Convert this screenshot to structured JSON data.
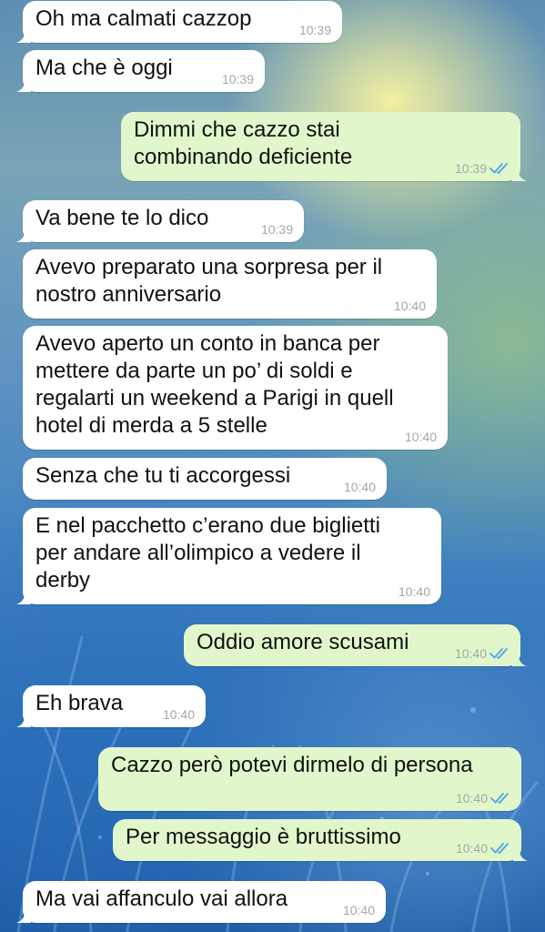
{
  "messages": [
    {
      "dir": "in",
      "text": "Oh ma calmati cazzop",
      "time": "10:39"
    },
    {
      "dir": "in",
      "text": "Ma che è oggi",
      "time": "10:39"
    },
    {
      "dir": "out",
      "text": "Dimmi che cazzo stai\ncombinando deficiente",
      "time": "10:39",
      "status": "read"
    },
    {
      "dir": "in",
      "text": "Va bene te lo dico",
      "time": "10:39"
    },
    {
      "dir": "in",
      "text": "Avevo preparato una sorpresa per il\nnostro anniversario",
      "time": "10:40"
    },
    {
      "dir": "in",
      "text": "Avevo aperto un conto in banca per\nmettere da parte un po’ di soldi e\nregalarti un weekend a Parigi in quell\nhotel di merda a 5 stelle",
      "time": "10:40"
    },
    {
      "dir": "in",
      "text": "Senza che tu ti accorgessi",
      "time": "10:40"
    },
    {
      "dir": "in",
      "text": "E nel pacchetto c’erano due biglietti\nper andare all’olimpico a vedere il\nderby",
      "time": "10:40"
    },
    {
      "dir": "out",
      "text": "Oddio amore scusami",
      "time": "10:40",
      "status": "read"
    },
    {
      "dir": "in",
      "text": "Eh brava",
      "time": "10:40"
    },
    {
      "dir": "out",
      "text": "Cazzo però potevi dirmelo di persona",
      "time": "10:40",
      "status": "read"
    },
    {
      "dir": "out",
      "text": "Per messaggio è bruttissimo",
      "time": "10:40",
      "status": "read"
    },
    {
      "dir": "in",
      "text": "Ma vai affanculo vai allora",
      "time": "10:40"
    }
  ],
  "colors": {
    "incoming_bubble": "#ffffff",
    "outgoing_bubble": "#e1f7cb",
    "read_ticks": "#4fa3e6",
    "timestamp": "#a3a9a4"
  },
  "icons": {
    "read_status": "double-check-icon"
  }
}
